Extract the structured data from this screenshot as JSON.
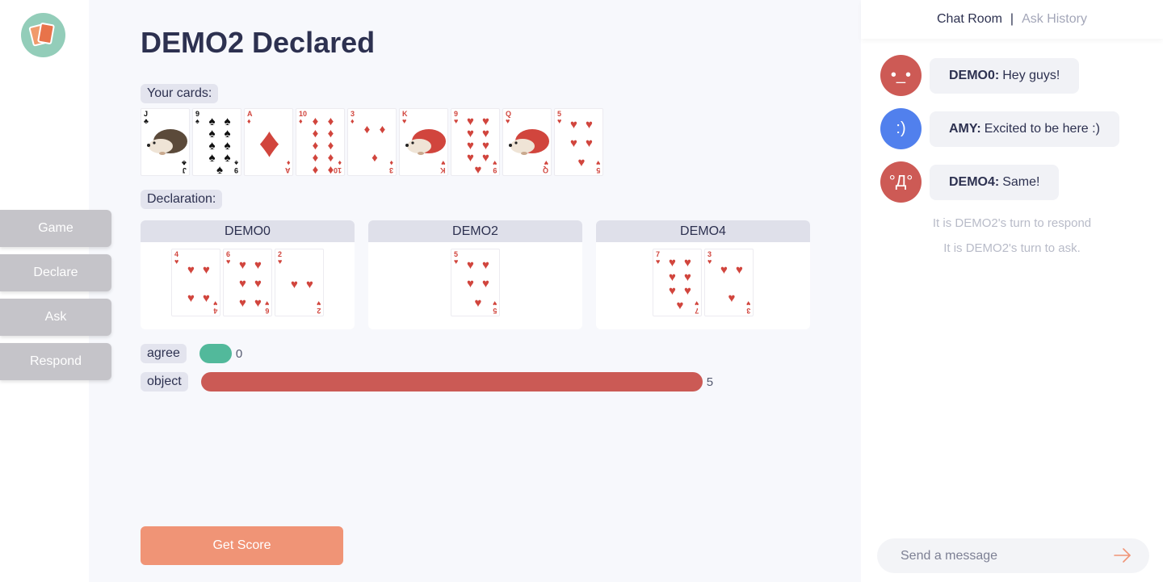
{
  "nav": {
    "items": [
      {
        "label": "Game"
      },
      {
        "label": "Declare"
      },
      {
        "label": "Ask"
      },
      {
        "label": "Respond"
      }
    ]
  },
  "main": {
    "title": "DEMO2 Declared",
    "your_cards_label": "Your cards:",
    "declaration_label": "Declaration:",
    "hand": [
      {
        "rank": "J",
        "suit": "♣",
        "color": "black",
        "face": true
      },
      {
        "rank": "9",
        "suit": "♠",
        "color": "black",
        "face": false
      },
      {
        "rank": "A",
        "suit": "♦",
        "color": "red",
        "face": false
      },
      {
        "rank": "10",
        "suit": "♦",
        "color": "red",
        "face": false
      },
      {
        "rank": "3",
        "suit": "♦",
        "color": "red",
        "face": false
      },
      {
        "rank": "K",
        "suit": "♥",
        "color": "red",
        "face": true
      },
      {
        "rank": "9",
        "suit": "♥",
        "color": "red",
        "face": false
      },
      {
        "rank": "Q",
        "suit": "♥",
        "color": "red",
        "face": true
      },
      {
        "rank": "5",
        "suit": "♥",
        "color": "red",
        "face": false
      }
    ],
    "declarations": [
      {
        "player": "DEMO0",
        "cards": [
          {
            "rank": "4",
            "suit": "♥"
          },
          {
            "rank": "6",
            "suit": "♥"
          },
          {
            "rank": "2",
            "suit": "♥"
          }
        ]
      },
      {
        "player": "DEMO2",
        "cards": [
          {
            "rank": "5",
            "suit": "♥"
          }
        ]
      },
      {
        "player": "DEMO4",
        "cards": [
          {
            "rank": "7",
            "suit": "♥"
          },
          {
            "rank": "3",
            "suit": "♥"
          }
        ]
      }
    ],
    "votes": {
      "agree": {
        "label": "agree",
        "count": "0",
        "color": "#52b99b"
      },
      "object": {
        "label": "object",
        "count": "5",
        "color": "#cb5a55"
      }
    },
    "get_score_label": "Get Score"
  },
  "chat": {
    "tab_active": "Chat Room",
    "tab_separator": "|",
    "tab_inactive": "Ask History",
    "messages": [
      {
        "sender": "DEMO0:",
        "text": "Hey guys!",
        "avatar_text": "•_•",
        "avatar_color": "#cd5a55"
      },
      {
        "sender": "AMY:",
        "text": "Excited to be here :)",
        "avatar_text": ":)",
        "avatar_color": "#5180ed"
      },
      {
        "sender": "DEMO4:",
        "text": "Same!",
        "avatar_text": "°Д°",
        "avatar_color": "#cd5a55"
      }
    ],
    "status_lines": [
      "It is DEMO2's turn to respond",
      "It is DEMO2's turn to ask."
    ],
    "input_placeholder": "Send a message",
    "colors": {
      "accent": "#f09476"
    }
  }
}
